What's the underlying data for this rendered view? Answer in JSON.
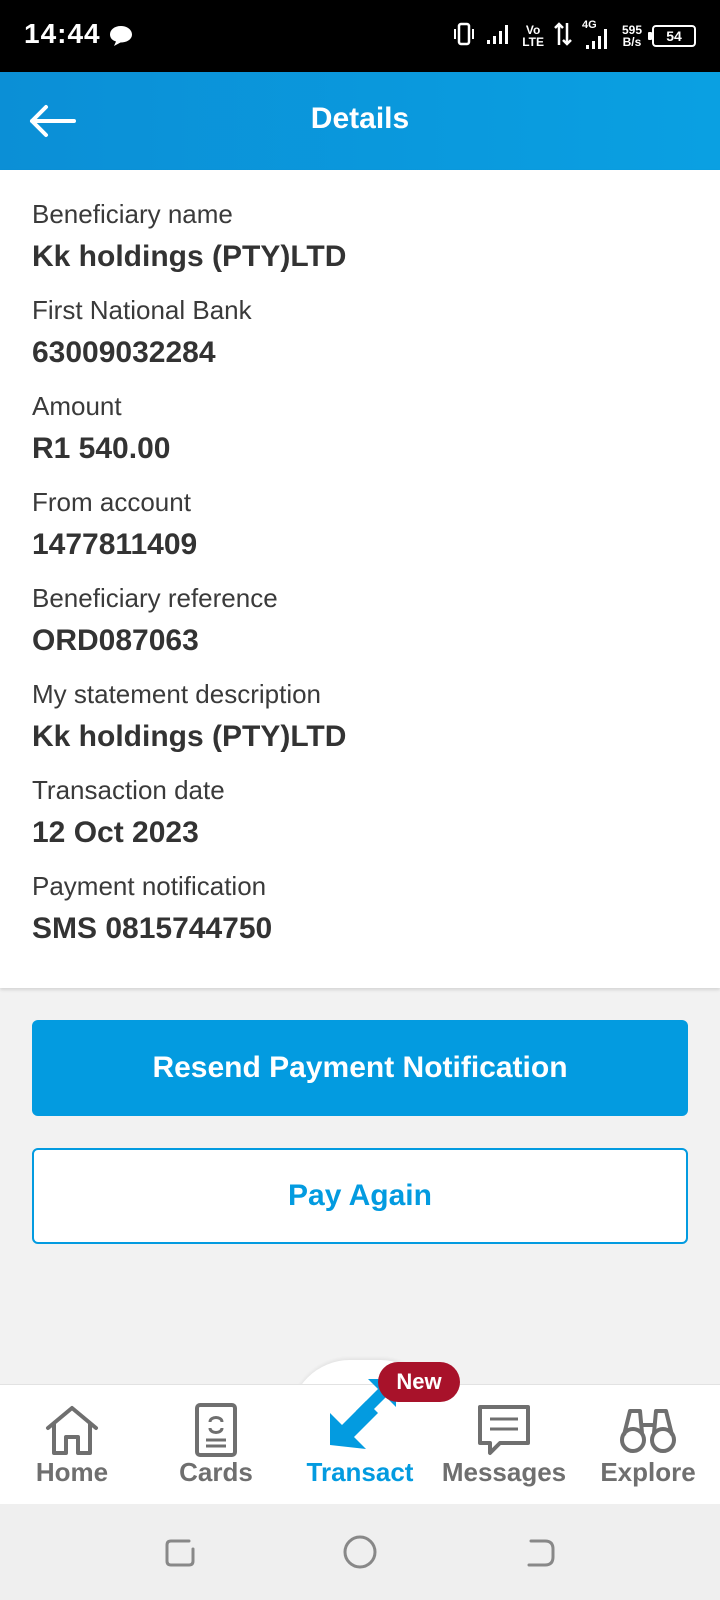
{
  "status_bar": {
    "time": "14:44",
    "network_speed_top": "595",
    "network_speed_bottom": "B/s",
    "battery": "54",
    "lte_top": "Vo",
    "lte_bottom": "LTE",
    "four_g": "4G"
  },
  "header": {
    "title": "Details"
  },
  "details": [
    {
      "label": "Beneficiary name",
      "value": "Kk holdings (PTY)LTD"
    },
    {
      "label": "First National Bank",
      "value": "63009032284"
    },
    {
      "label": "Amount",
      "value": "R1 540.00"
    },
    {
      "label": "From account",
      "value": "1477811409"
    },
    {
      "label": "Beneficiary reference",
      "value": "ORD087063"
    },
    {
      "label": "My statement description",
      "value": "Kk holdings (PTY)LTD"
    },
    {
      "label": "Transaction date",
      "value": "12 Oct 2023"
    },
    {
      "label": "Payment notification",
      "value": "SMS 0815744750"
    }
  ],
  "actions": {
    "resend_label": "Resend Payment Notification",
    "pay_again_label": "Pay Again"
  },
  "bottom_nav": {
    "items": [
      {
        "label": "Home",
        "icon": "home-icon"
      },
      {
        "label": "Cards",
        "icon": "card-icon"
      },
      {
        "label": "Transact",
        "icon": "transact-icon"
      },
      {
        "label": "Messages",
        "icon": "message-icon"
      },
      {
        "label": "Explore",
        "icon": "binoculars-icon"
      }
    ],
    "active": "Transact",
    "badge": "New"
  },
  "colors": {
    "accent": "#039be0",
    "header": "#0b8fd6",
    "badge": "#a8122a"
  }
}
